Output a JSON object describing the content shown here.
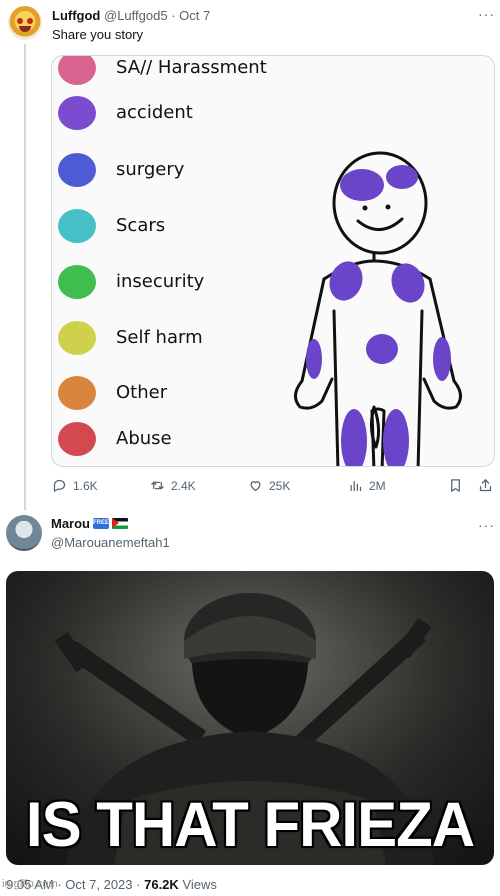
{
  "tweet1": {
    "author_name": "Luffgod",
    "handle": "@Luffgod5",
    "date": "Oct 7",
    "text": "Share you story",
    "legend": [
      {
        "label": "SA// Harassment",
        "color": "#d9628e"
      },
      {
        "label": "accident",
        "color": "#7b4bd0"
      },
      {
        "label": "surgery",
        "color": "#4d5bd4"
      },
      {
        "label": "Scars",
        "color": "#45c0c7"
      },
      {
        "label": "insecurity",
        "color": "#3fbd4f"
      },
      {
        "label": "Self harm",
        "color": "#cfd14c"
      },
      {
        "label": "Other",
        "color": "#d9863c"
      },
      {
        "label": "Abuse",
        "color": "#d2494f"
      }
    ],
    "figure_mark_color": "#6b45c9",
    "actions": {
      "replies": "1.6K",
      "reposts": "2.4K",
      "likes": "25K",
      "views": "2M"
    }
  },
  "tweet2": {
    "author_name": "Marou",
    "handle": "@Marouanemeftah1",
    "free_badge": "FREE",
    "meme_caption": "IS THAT FRIEZA",
    "time": "9:05 AM",
    "date": "Oct 7, 2023",
    "views_count": "76.2K",
    "views_label": "Views"
  },
  "watermark": "imgflip.com",
  "colors": {
    "muted": "#536471",
    "border": "#cfd9de"
  }
}
